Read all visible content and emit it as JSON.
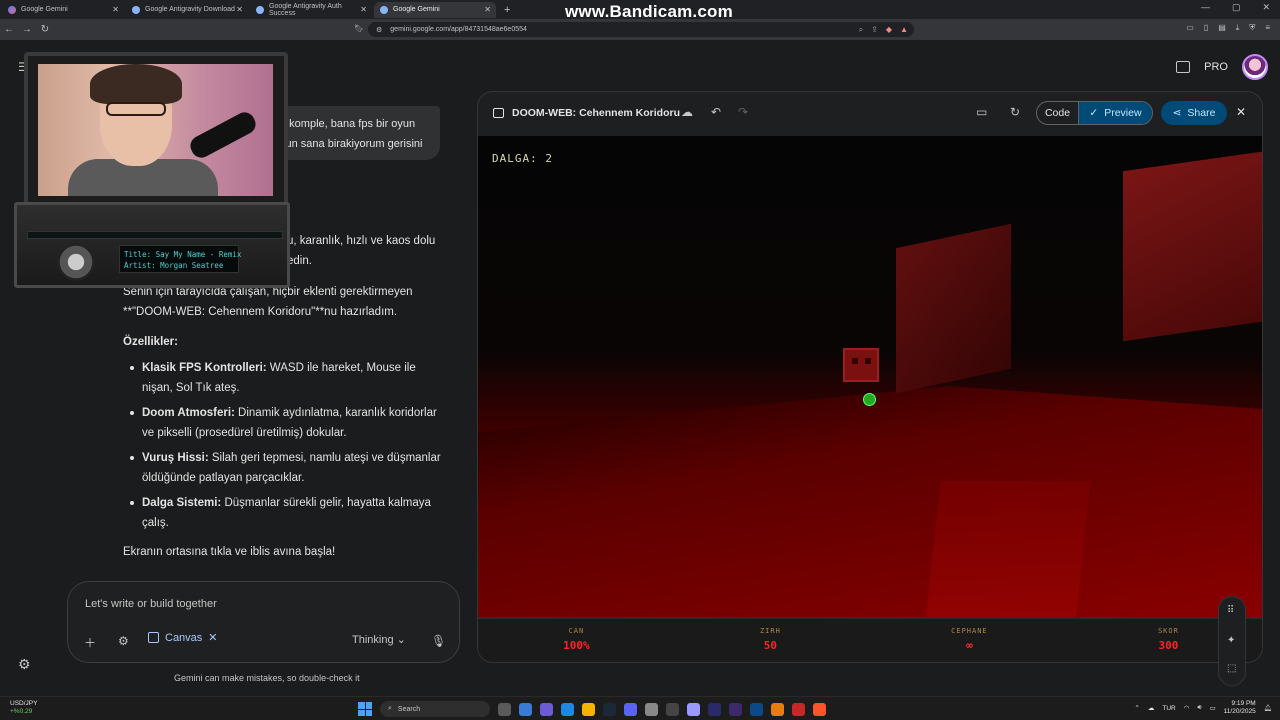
{
  "browser": {
    "tabs": [
      {
        "label": "Google Gemini",
        "active": false
      },
      {
        "label": "Google Antigravity Download",
        "active": false
      },
      {
        "label": "Google Antigravity Auth Success",
        "active": false
      },
      {
        "label": "Google Gemini",
        "active": true
      }
    ],
    "url": "gemini.google.com/app/84731548ae6e0554",
    "watermark": "www.Bandicam.com"
  },
  "header": {
    "plan": "PRO"
  },
  "chat": {
    "user_line1": "u komple, bana fps bir oyun",
    "user_line2": "sun sana birakiyorum gerisini",
    "resp_frag1": "u, karanlık, hızlı ve kaos dolu",
    "resp_frag2": "edin.",
    "resp_p1_line1": "Senin için tarayıcıda çalışan, hiçbir eklenti gerektirmeyen",
    "resp_p1_line2": "**\"DOOM-WEB: Cehennem Koridoru\"**nu hazırladım.",
    "features_title": "Özellikler:",
    "features": [
      {
        "title": "Klasik FPS Kontrolleri:",
        "line1": " WASD ile hareket, Mouse ile",
        "line2": "nişan, Sol Tık ateş."
      },
      {
        "title": "Doom Atmosferi:",
        "line1": " Dinamik aydınlatma, karanlık koridorlar",
        "line2": "ve pikselli (prosedürel üretilmiş) dokular."
      },
      {
        "title": "Vuruş Hissi:",
        "line1": " Silah geri tepmesi, namlu ateşi ve düşmanlar",
        "line2": "öldüğünde patlayan parçacıklar."
      },
      {
        "title": "Dalga Sistemi:",
        "line1": " Düşmanlar sürekli gelir, hayatta kalmaya",
        "line2": "çalış."
      }
    ],
    "closing": "Ekranın ortasına tıkla ve iblis avına başla!"
  },
  "composer": {
    "placeholder": "Let's write or build together",
    "canvas_label": "Canvas",
    "mode_label": "Thinking",
    "disclaimer": "Gemini can make mistakes, so double-check it"
  },
  "canvas": {
    "title": "DOOM-WEB: Cehennem Koridoru",
    "code_label": "Code",
    "preview_label": "Preview",
    "share_label": "Share",
    "wave_text": "DALGA: 2",
    "hud": [
      {
        "label": "CAN",
        "value": "100%"
      },
      {
        "label": "ZIRH",
        "value": "50"
      },
      {
        "label": "CEPHANE",
        "value": "∞"
      },
      {
        "label": "SKOR",
        "value": "300"
      }
    ]
  },
  "webcam": {
    "track_title": "Title: Say My Name - Remix",
    "track_artist": "Artist: Morgan Seatree"
  },
  "taskbar": {
    "ticker_name": "USD/JPY",
    "ticker_change": "+%0.29",
    "search_label": "Search",
    "lang": "TUR",
    "time": "9:19 PM",
    "date": "11/20/2025"
  }
}
